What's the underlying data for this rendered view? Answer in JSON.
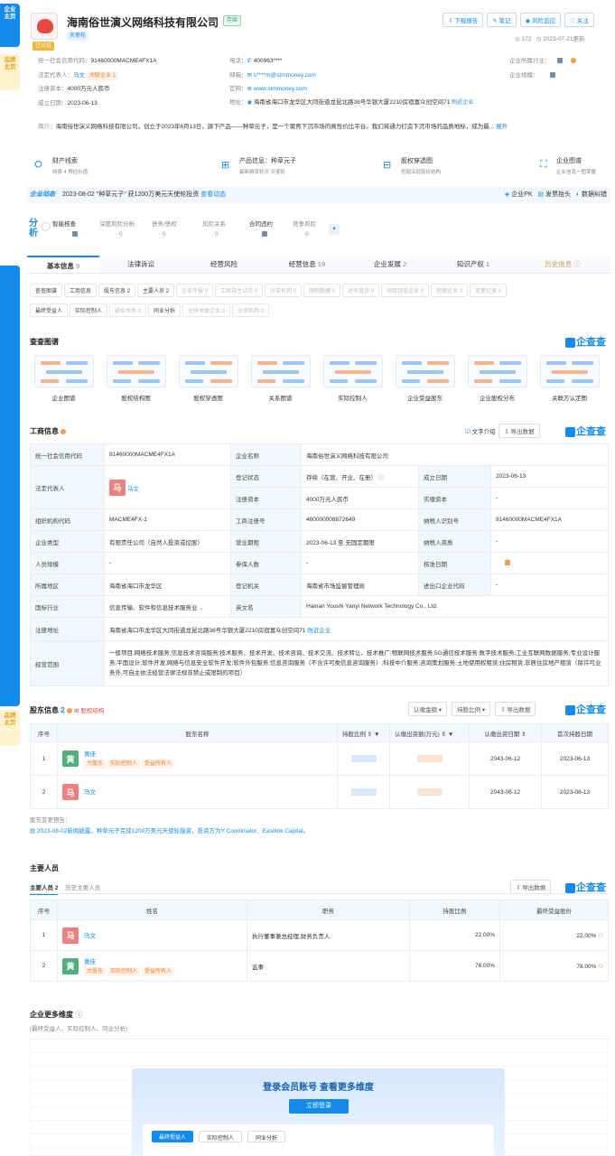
{
  "sidebar": {
    "top_tab": "企业主页",
    "top_sub": "品牌主页",
    "mid_tab": "主页",
    "bottom_tab": "主页",
    "bottom_sub": "品牌主页"
  },
  "header": {
    "company_name": "海南俗世演义网络科技有限公司",
    "status_badge": "存续",
    "sub_tag": "天使轮",
    "vip_tag": "已认证",
    "actions": [
      "下载报告",
      "笔记",
      "风险监控",
      "关注"
    ],
    "views": "172",
    "updated": "2023-07-21更新"
  },
  "info": {
    "credit_code_label": "统一社会信用代码：",
    "credit_code": "91460000MACME4FX1A",
    "phone_label": "电话：",
    "phone": "400963****",
    "industry_label": "企业所属行业：",
    "legal_label": "法定代表人：",
    "legal_name": "马文",
    "legal_tag": "关联企业 1",
    "email_label": "邮箱：",
    "email": "s****m@stmmoney.com",
    "scale_label": "企业规模：",
    "capital_label": "注册资本：",
    "capital": "4000万元人民币",
    "website_label": "官网：",
    "website": "www.stmmoney.com",
    "founded_label": "成立日期：",
    "founded": "2023-06-13",
    "address_label": "地址：",
    "address": "海南省海口市龙华区大同街道龙昆北路38号华银大厦2210房宿富众创空间71",
    "nearby": "附近企业",
    "intro_label": "简介：",
    "intro": "海南俗世演义网络科技有限公司，创立于2023年6月13日，旗下产品——种草元子，是一个聚焦下沉市场的真性价比平台。我们将通力打造下沉市场的品质地标，成为最...",
    "intro_more": "展开"
  },
  "features": [
    {
      "title": "财产线索",
      "sub": "线索 4  预估价值"
    },
    {
      "title": "产品信息：种草元子",
      "sub": "最新融资轮次 天使轮"
    },
    {
      "title": "股权穿透图",
      "sub": "挖掘深层股权结构"
    },
    {
      "title": "企业图谱",
      "sub": "企业信息一图掌握"
    }
  ],
  "news": {
    "label": "企业动态",
    "date": "2023-08-02",
    "text": "\"种草元子\" 获1200万美元天使轮投资",
    "link": "查看动态",
    "right": [
      "企业PK",
      "发票抬头",
      "数据纠错"
    ]
  },
  "analysis": {
    "label": "分析",
    "items": [
      {
        "name": "智能核查",
        "value": ""
      },
      {
        "name": "深度风险分析",
        "value": "0"
      },
      {
        "name": "债务/债权",
        "value": "0"
      },
      {
        "name": "风险关系",
        "value": "0"
      },
      {
        "name": "合同违约",
        "value": ""
      },
      {
        "name": "竞争风险",
        "value": "0"
      }
    ]
  },
  "main_tabs": [
    {
      "label": "基本信息",
      "count": "9"
    },
    {
      "label": "法律诉讼",
      "count": ""
    },
    {
      "label": "经营风险",
      "count": ""
    },
    {
      "label": "经营信息",
      "count": "19"
    },
    {
      "label": "企业发展",
      "count": "2"
    },
    {
      "label": "知识产权",
      "count": "1"
    },
    {
      "label": "历史信息",
      "count": ""
    }
  ],
  "sub_tabs_row1": [
    {
      "label": "查查图谱",
      "dis": false
    },
    {
      "label": "工商信息",
      "dis": false
    },
    {
      "label": "股东信息 2",
      "dis": false
    },
    {
      "label": "主要人员 2",
      "dis": false
    },
    {
      "label": "企业年报 0",
      "dis": true
    },
    {
      "label": "工商自主公示 0",
      "dis": true
    },
    {
      "label": "分支机构 0",
      "dis": true
    },
    {
      "label": "限制数据 0",
      "dis": true
    },
    {
      "label": "对外投资 0",
      "dis": true
    },
    {
      "label": "间接持股企业 0",
      "dis": true
    },
    {
      "label": "控制企业 0",
      "dis": true
    },
    {
      "label": "变更记录 0",
      "dis": true
    }
  ],
  "sub_tabs_row2": [
    {
      "label": "最终受益人",
      "dis": false
    },
    {
      "label": "实际控制人",
      "dis": false
    },
    {
      "label": "疑似关系 0",
      "dis": true
    },
    {
      "label": "同业分析",
      "dis": false
    },
    {
      "label": "全球关联企业 0",
      "dis": true
    },
    {
      "label": "分支机构 0",
      "dis": true
    }
  ],
  "graph": {
    "title": "查查图谱",
    "brand": "企查查",
    "items": [
      "企业图谱",
      "股权结构图",
      "股权穿透图",
      "关系图谱",
      "实际控制人",
      "企业受益股东",
      "企业股权分布",
      "关联方认定图"
    ]
  },
  "business": {
    "title": "工商信息",
    "text_intro": "文字介绍",
    "export": "导出数据",
    "rows": {
      "credit_label": "统一社会信用代码",
      "credit": "91460000MACME4FX1A",
      "name_label": "企业名称",
      "name": "海南俗世演义网络科技有限公司",
      "legal_label": "法定代表人",
      "legal": "马文",
      "legal_avatar": "马",
      "status_label": "登记状态",
      "status": "存续（在营、开业、在册）",
      "found_label": "成立日期",
      "found": "2023-06-13",
      "cap_label": "注册资本",
      "cap": "4000万元人民币",
      "paid_label": "实缴资本",
      "paid": "-",
      "org_label": "组织机构代码",
      "org": "MACME4FX-1",
      "reg_label": "工商注册号",
      "reg": "460000008872649",
      "tax_label": "纳税人识别号",
      "tax": "91460000MACME4FX1A",
      "type_label": "企业类型",
      "type": "有限责任公司（自然人投资或控股）",
      "term_label": "营业期限",
      "term": "2023-06-13 至 无固定期限",
      "taxq_label": "纳税人资质",
      "taxq": "-",
      "staff_label": "人员规模",
      "staff": "-",
      "insured_label": "参保人数",
      "insured": "-",
      "check_label": "核准日期",
      "region_label": "所属地区",
      "region": "海南省海口市龙华区",
      "auth_label": "登记机关",
      "auth": "海南省市场监督管理局",
      "ie_label": "进出口企业代码",
      "ie": "-",
      "ind_label": "国标行业",
      "ind": "信息传输、软件和信息技术服务业",
      "en_label": "英文名",
      "en": "Hainan Youshi Yanyi Network Technology Co., Ltd.",
      "addr_label": "注册地址",
      "addr": "海南省海口市龙华区大同街道龙昆北路38号华银大厦2210房宿富众创空间71",
      "addr_link": "附近企业",
      "scope_label": "经营范围",
      "scope": "一般项目:网络技术服务;信息技术咨询服务;技术服务、技术开发、技术咨询、技术交流、技术转让、技术推广;物联网技术服务;5G通信技术服务;数字技术服务;工业互联网数据服务;专业设计服务;平面设计;软件开发;网络与信息安全软件开发;软件外包服务;信息咨询服务（不含许可类信息咨询服务）;科技中介服务;咨询策划服务;土地使用权租赁;住房租赁;非居住房地产租赁（除许可业务外,可自主依法经营法律法规非禁止或限制的项目）"
    }
  },
  "shareholders": {
    "title": "股东信息",
    "count": "2",
    "link": "股权结构",
    "filters": [
      "认缴金额",
      "持股比例",
      "导出数据"
    ],
    "headers": [
      "序号",
      "股东名称",
      "持股比例",
      "认缴出资额(万元)",
      "认缴出资日期",
      "首次持股日期"
    ],
    "rows": [
      {
        "idx": "1",
        "name": "黄佳",
        "avatar": "黄",
        "color": "#4fb07a",
        "tags": [
          "大股东",
          "实际控制人",
          "受益所有人"
        ],
        "date": "2043-06-12",
        "first": "2023-06-13"
      },
      {
        "idx": "2",
        "name": "马文",
        "avatar": "马",
        "color": "#ef7f7f",
        "tags": [],
        "date": "2043-06-12",
        "first": "2023-06-13"
      }
    ],
    "note_label": "股东变更预告：",
    "note": "2023-08-02新闻披露，种草元子完成1200万美元天使轮融资，投资方为Y Combinator、Eastlink Capital。"
  },
  "staff": {
    "title": "主要人员",
    "tab1": "主要人员 2",
    "tab2": "历史主要人员",
    "export": "导出数据",
    "headers": [
      "序号",
      "姓名",
      "职务",
      "持股比例",
      "最终受益股份"
    ],
    "rows": [
      {
        "idx": "1",
        "name": "马文",
        "avatar": "马",
        "color": "#ef7f7f",
        "tags": [],
        "role": "执行董事兼总经理,财务负责人",
        "ratio": "22.00%",
        "benefit": "22.00%"
      },
      {
        "idx": "2",
        "name": "黄佳",
        "avatar": "黄",
        "color": "#4fb07a",
        "tags": [
          "大股东",
          "实际控制人",
          "受益所有人"
        ],
        "role": "监事",
        "ratio": "78.00%",
        "benefit": "78.00%"
      }
    ]
  },
  "more": {
    "title": "企业更多维度",
    "sub": "(最终受益人、实际控制人、同业分析)",
    "login_title": "登录会员账号 查看更多维度",
    "login_btn": "立即登录",
    "tabs": [
      "最终受益人",
      "实际控制人",
      "同业分析"
    ]
  }
}
